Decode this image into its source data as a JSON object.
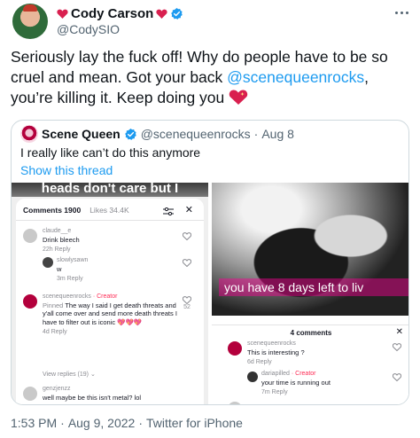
{
  "author": {
    "display_name": "Cody Carson",
    "handle": "@CodySIO"
  },
  "tweet": {
    "text_before": "Seriously lay the fuck off! Why do people have to be so cruel and mean. Got your back ",
    "mention": "@scenequeenrocks",
    "text_after": ", you’re killing it. Keep doing you"
  },
  "quote": {
    "display_name": "Scene Queen",
    "handle": "@scenequeenrocks",
    "separator": "·",
    "date": "Aug 8",
    "text": "I really like can’t do this anymore",
    "show_thread": "Show this thread",
    "left_shot": {
      "banner": "heads don't care but I",
      "tab_comments": "Comments 1900",
      "tab_likes": "Likes 34.4K",
      "comments": [
        {
          "user": "claude__e",
          "text": "Drink bleech",
          "meta": "22h  Reply"
        },
        {
          "user": "slowlysawn",
          "text": "w",
          "meta": "3m  Reply"
        },
        {
          "user": "scenequeenrocks",
          "creator": "· Creator",
          "pinned": "Pinned",
          "text": "The way I said I get death threats and y'all come over and send more death threats I have to filter out is iconic",
          "hearts": "💖💖💖",
          "meta": "4d  Reply",
          "like_count": "52"
        },
        {
          "user": "",
          "text": "",
          "meta": "View replies (19) ⌄"
        },
        {
          "user": "genzjenzz",
          "text": "well maybe be this isn't metal? lol",
          "meta": ""
        }
      ]
    },
    "right_shot": {
      "overlay": "you have 8 days left to liv",
      "count": "4 comments",
      "comments": [
        {
          "user": "scenequeenrocks",
          "text": "This is interesting ?",
          "meta": "6d  Reply"
        },
        {
          "user": "dariapilled",
          "creator": "· Creator",
          "text": "your time is running out",
          "meta": "7m  Reply"
        }
      ]
    }
  },
  "footer": {
    "time": "1:53 PM",
    "dot1": "·",
    "date": "Aug 9, 2022",
    "dot2": "·",
    "source": "Twitter for iPhone"
  }
}
